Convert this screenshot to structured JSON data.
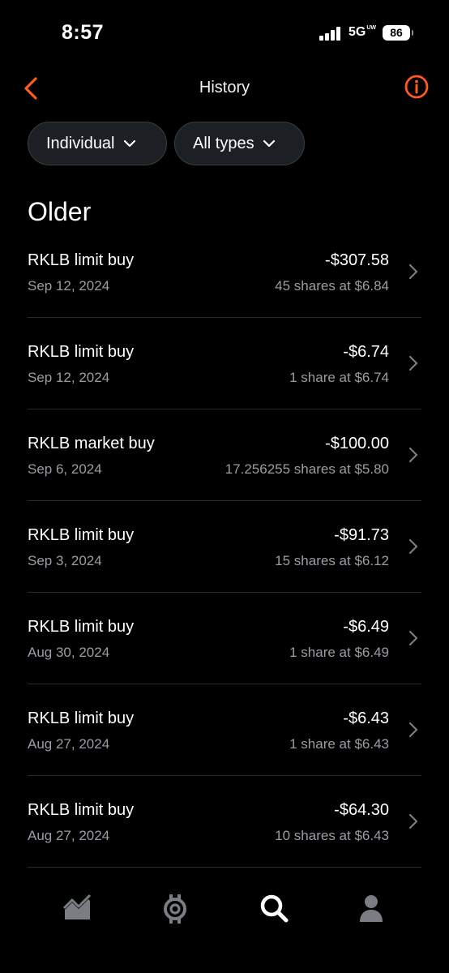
{
  "status": {
    "time": "8:57",
    "network": "5G",
    "network_sub": "UW",
    "battery": "86"
  },
  "header": {
    "title": "History"
  },
  "filters": [
    {
      "label": "Individual"
    },
    {
      "label": "All types"
    }
  ],
  "section": {
    "title": "Older"
  },
  "transactions": [
    {
      "title": "RKLB limit buy",
      "date": "Sep 12, 2024",
      "amount": "-$307.58",
      "detail": "45 shares at $6.84"
    },
    {
      "title": "RKLB limit buy",
      "date": "Sep 12, 2024",
      "amount": "-$6.74",
      "detail": "1 share at $6.74"
    },
    {
      "title": "RKLB market buy",
      "date": "Sep 6, 2024",
      "amount": "-$100.00",
      "detail": "17.256255 shares at $5.80"
    },
    {
      "title": "RKLB limit buy",
      "date": "Sep 3, 2024",
      "amount": "-$91.73",
      "detail": "15 shares at $6.12"
    },
    {
      "title": "RKLB limit buy",
      "date": "Aug 30, 2024",
      "amount": "-$6.49",
      "detail": "1 share at $6.49"
    },
    {
      "title": "RKLB limit buy",
      "date": "Aug 27, 2024",
      "amount": "-$6.43",
      "detail": "1 share at $6.43"
    },
    {
      "title": "RKLB limit buy",
      "date": "Aug 27, 2024",
      "amount": "-$64.30",
      "detail": "10 shares at $6.43"
    }
  ],
  "tabs": [
    {
      "icon": "investing-chart-icon"
    },
    {
      "icon": "crypto-icon"
    },
    {
      "icon": "search-icon"
    },
    {
      "icon": "account-icon"
    }
  ],
  "colors": {
    "accent": "#ff5a1f",
    "background": "#000000",
    "muted_text": "#9a9ea4"
  }
}
